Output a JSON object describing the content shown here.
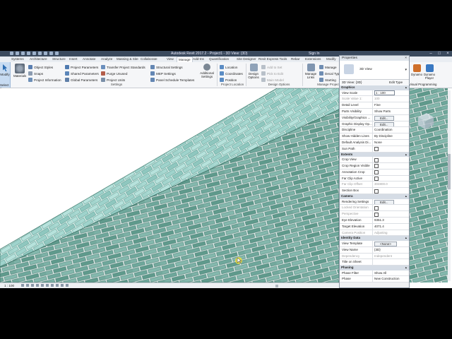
{
  "app": {
    "title": "Autodesk Revit 2017.2 -   Project1 - 3D View: {3D}",
    "sign_in": "Sign In"
  },
  "tabs": [
    "Systems",
    "Architecture",
    "Structure",
    "Insert",
    "Annotate",
    "Analyze",
    "Massing & Site",
    "Collaborate",
    "View",
    "Manage",
    "Add-Ins",
    "Quantification",
    "Site Designer",
    "Revit Express Tools",
    "Rebar",
    "Extensions",
    "Modify"
  ],
  "active_tab_index": 9,
  "ribbon": {
    "modify_label": "Modify",
    "select_label": "Select",
    "materials_label": "Materials",
    "settings_items": [
      "Object Styles",
      "Snaps",
      "Project Information",
      "Project Parameters",
      "Shared Parameters",
      "Global Parameters",
      "Transfer Project Standards",
      "Purge Unused",
      "Project Units"
    ],
    "settings_items_2": [
      "Structural Settings",
      "MEP Settings",
      "Panel Schedule Templates"
    ],
    "additional_settings_label": "Additional Settings",
    "settings_panel_label": "Settings",
    "location_items": [
      "Location",
      "Coordinates",
      "Position"
    ],
    "project_location_label": "Project Location",
    "design_options_label": "Design Options",
    "design_option_items": [
      "Add to Set",
      "Pick to Edit",
      "Main Model"
    ],
    "design_options_panel_label": "Design Options",
    "manage_links_label": "Manage Links",
    "manage_project_items": [
      "Manage",
      "Decal Types",
      "Starting"
    ],
    "manage_project_label": "Manage Project",
    "dynamo_label": "Dynamo",
    "dynamo_player_label": "Dynamo Player",
    "visual_programming_label": "Visual Programming"
  },
  "status": {
    "scale": "1 : 100"
  },
  "properties": {
    "header": "Properties",
    "type_name": "3D View",
    "filter_value": "3D View: {3D}",
    "edit_type": "Edit Type",
    "groups": [
      {
        "name": "Graphics",
        "rows": [
          {
            "k": "View Scale",
            "v": "1 : 100",
            "kind": "input"
          },
          {
            "k": "Scale Value    1:",
            "v": "100",
            "kind": "dim"
          },
          {
            "k": "Detail Level",
            "v": "Fine"
          },
          {
            "k": "Parts Visibility",
            "v": "Show Parts"
          },
          {
            "k": "Visibility/Graphics ...",
            "v": "Edit...",
            "kind": "button"
          },
          {
            "k": "Graphic Display Op...",
            "v": "Edit...",
            "kind": "button"
          },
          {
            "k": "Discipline",
            "v": "Coordination"
          },
          {
            "k": "Show Hidden Lines",
            "v": "By Discipline"
          },
          {
            "k": "Default Analysis Di...",
            "v": "None"
          },
          {
            "k": "Sun Path",
            "v": "",
            "kind": "check"
          }
        ]
      },
      {
        "name": "Extents",
        "rows": [
          {
            "k": "Crop View",
            "v": "",
            "kind": "check"
          },
          {
            "k": "Crop Region Visible",
            "v": "",
            "kind": "check"
          },
          {
            "k": "Annotation Crop",
            "v": "",
            "kind": "check"
          },
          {
            "k": "Far Clip Active",
            "v": "",
            "kind": "check"
          },
          {
            "k": "Far Clip Offset",
            "v": "304800.0",
            "kind": "dim"
          },
          {
            "k": "Section Box",
            "v": "",
            "kind": "check"
          }
        ]
      },
      {
        "name": "Camera",
        "rows": [
          {
            "k": "Rendering Settings",
            "v": "Edit...",
            "kind": "button"
          },
          {
            "k": "Locked Orientation",
            "v": "",
            "kind": "dimcheck"
          },
          {
            "k": "Perspective",
            "v": "",
            "kind": "dimcheck"
          },
          {
            "k": "Eye Elevation",
            "v": "9351.3"
          },
          {
            "k": "Target Elevation",
            "v": "4071.4"
          },
          {
            "k": "Camera Position",
            "v": "Adjusting",
            "kind": "dim"
          }
        ]
      },
      {
        "name": "Identity Data",
        "rows": [
          {
            "k": "View Template",
            "v": "<None>",
            "kind": "button"
          },
          {
            "k": "View Name",
            "v": "{3D}"
          },
          {
            "k": "Dependency",
            "v": "Independent",
            "kind": "dim"
          },
          {
            "k": "Title on Sheet",
            "v": ""
          }
        ]
      },
      {
        "name": "Phasing",
        "rows": [
          {
            "k": "Phase Filter",
            "v": "Show All"
          },
          {
            "k": "Phase",
            "v": "New Construction"
          }
        ]
      }
    ]
  },
  "colors": {
    "brick_light": "#a9d8d2",
    "brick_dark": "#5f9a8c",
    "mortar": "#e8f4f2",
    "cursor_highlight": "#f5e23a"
  },
  "icons": [
    "modify-icon",
    "materials-icon",
    "object-styles-icon",
    "dynamo-icon",
    "viewcube-icon"
  ]
}
